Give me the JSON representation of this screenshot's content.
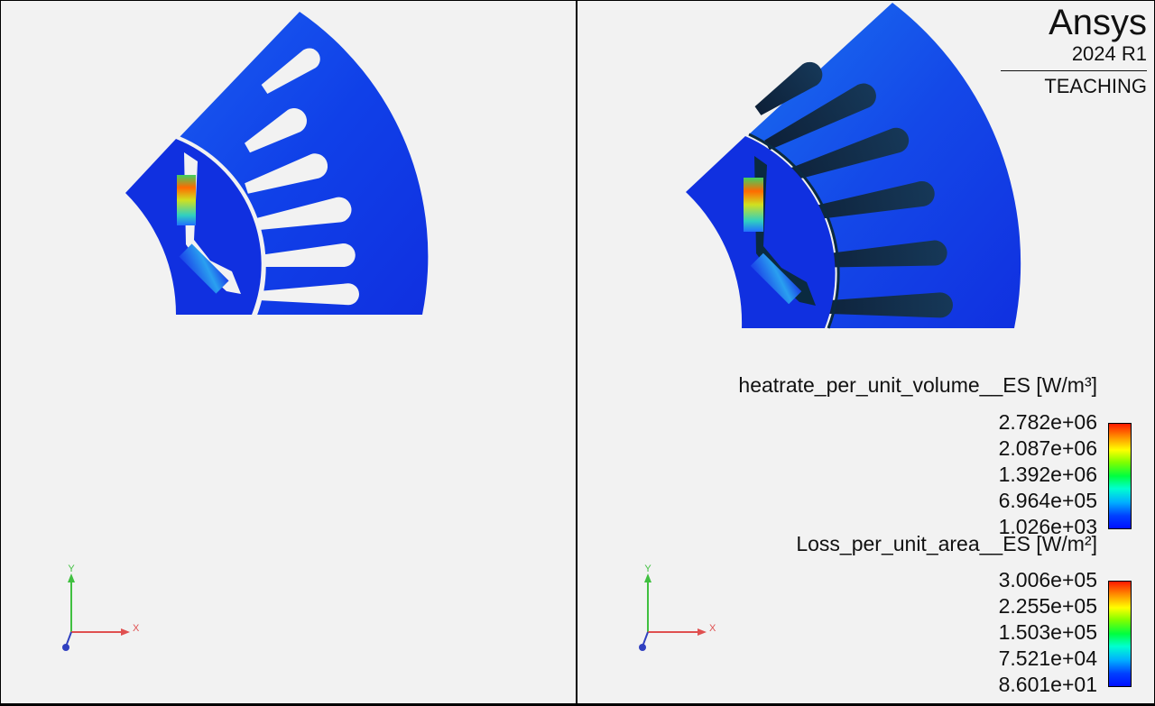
{
  "brand": {
    "name": "Ansys",
    "version": "2024 R1",
    "edition": "TEACHING"
  },
  "legend_heat": {
    "title": "heatrate_per_unit_volume__ES [W/m³]",
    "values": [
      "2.782e+06",
      "2.087e+06",
      "1.392e+06",
      "6.964e+05",
      "1.026e+03"
    ]
  },
  "legend_loss": {
    "title": "Loss_per_unit_area__ES [W/m²]",
    "values": [
      "3.006e+05",
      "2.255e+05",
      "1.503e+05",
      "7.521e+04",
      "8.601e+01"
    ]
  },
  "axes": {
    "x_label": "X",
    "y_label": "Y"
  },
  "colors": {
    "viewport_bg": "#f2f2f2",
    "steel_blue": "#1030e0",
    "slot_dark": "#0a2a40",
    "axis_x": "#e05050",
    "axis_y": "#40c040",
    "axis_z": "#3040c0"
  }
}
